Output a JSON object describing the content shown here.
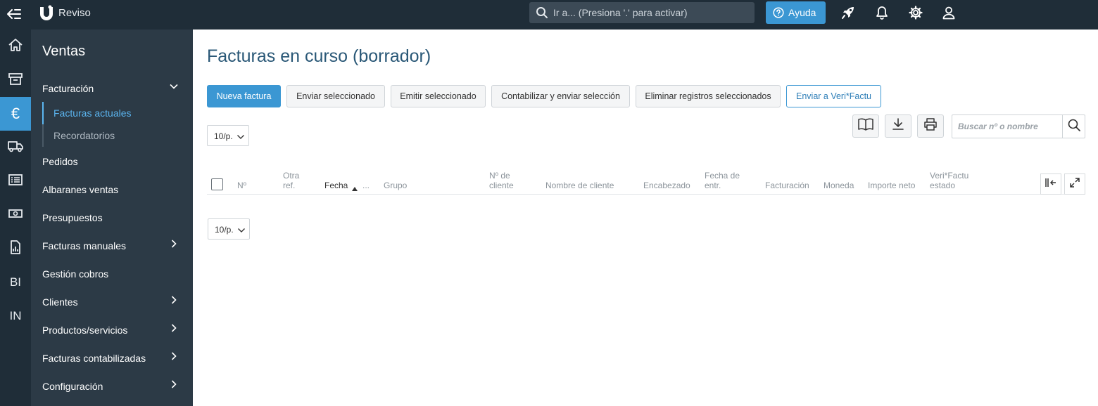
{
  "topbar": {
    "brand": "Reviso",
    "search_placeholder": "Ir a... (Presiona '.' para activar)",
    "help_label": "Ayuda",
    "colors": {
      "bar": "#1f2d38",
      "accent": "#3b97d3"
    }
  },
  "rail": {
    "items": [
      {
        "icon": "home-icon"
      },
      {
        "icon": "archive-icon"
      },
      {
        "icon": "euro-icon",
        "label": "€",
        "active": true
      },
      {
        "icon": "truck-icon"
      },
      {
        "icon": "list-icon"
      },
      {
        "icon": "money-icon"
      },
      {
        "icon": "report-icon"
      },
      {
        "icon": "bi-icon",
        "label": "BI"
      },
      {
        "icon": "in-icon",
        "label": "IN"
      }
    ]
  },
  "sidebar": {
    "title": "Ventas",
    "items": [
      {
        "label": "Facturación",
        "expanded": true
      },
      {
        "label": "Facturas actuales",
        "active": true
      },
      {
        "label": "Recordatorios"
      },
      {
        "label": "Pedidos"
      },
      {
        "label": "Albaranes ventas"
      },
      {
        "label": "Presupuestos"
      },
      {
        "label": "Facturas manuales",
        "has_children": true
      },
      {
        "label": "Gestión cobros"
      },
      {
        "label": "Clientes",
        "has_children": true
      },
      {
        "label": "Productos/servicios",
        "has_children": true
      },
      {
        "label": "Facturas contabilizadas",
        "has_children": true
      },
      {
        "label": "Configuración",
        "has_children": true
      }
    ]
  },
  "main": {
    "title": "Facturas en curso (borrador)",
    "actions": [
      "Nueva factura",
      "Enviar seleccionado",
      "Emitir seleccionado",
      "Contabilizar y enviar selección",
      "Eliminar registros seleccionados",
      "Enviar a Veri*Factu"
    ],
    "page_size": "10/p.",
    "search_placeholder": "Buscar nº o nombre",
    "table": {
      "headers": [
        "Nº",
        "Otra ref.",
        "Fecha",
        "...",
        "Grupo",
        "Nº de cliente",
        "Nombre de cliente",
        "Encabezado",
        "Fecha de entr.",
        "Facturación",
        "Moneda",
        "Importe neto",
        "Veri*Factu estado"
      ],
      "sorted_column": "Fecha",
      "sort_direction": "ascending",
      "rows": []
    }
  }
}
